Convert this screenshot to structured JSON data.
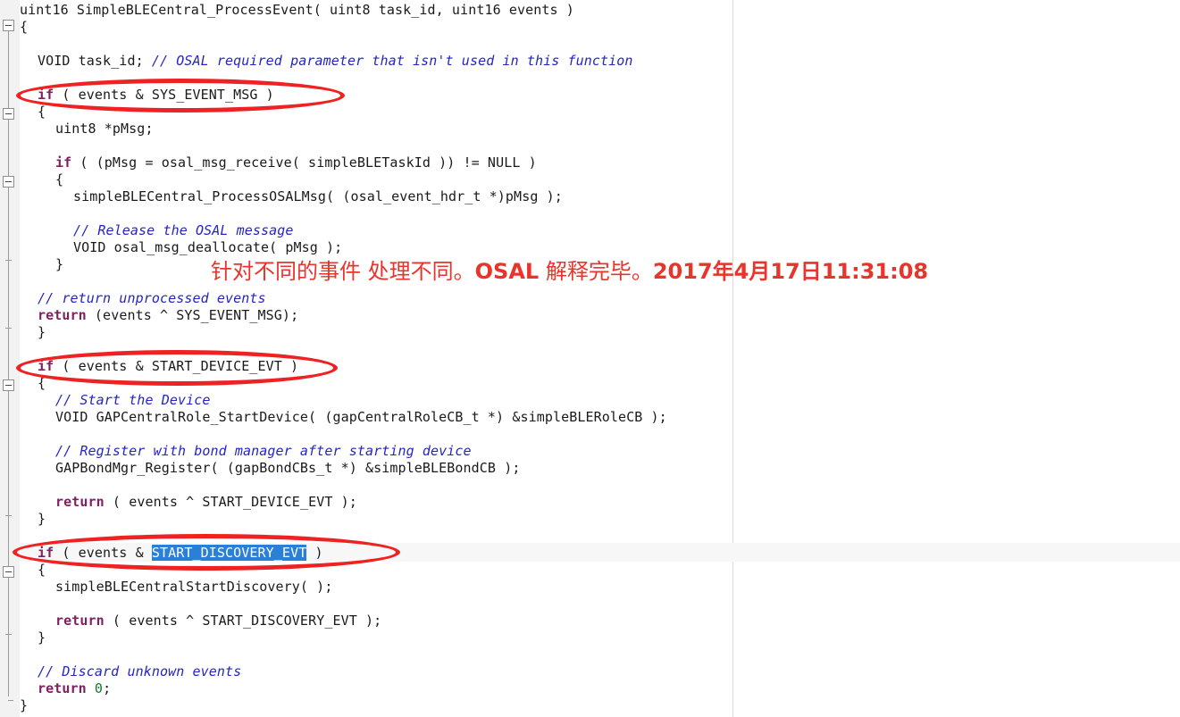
{
  "editor": {
    "language": "c",
    "font_size_px": 15,
    "colors": {
      "background": "#ffffff",
      "text": "#1a1a1a",
      "keyword": "#7f2060",
      "comment": "#2424c8",
      "number": "#107a2f",
      "selection_bg": "#2a7fd6",
      "selection_fg": "#ffffff",
      "gutter_bg": "#f2f2f2",
      "current_line_bg": "#f7f7f7",
      "column_guide": "#dcdcdc",
      "annotation_red": "#ee2222",
      "annotation_text_red": "#e8342a"
    },
    "lines": [
      {
        "indent": 0,
        "text": "uint16 SimpleBLECentral_ProcessEvent( uint8 task_id, uint16 events )"
      },
      {
        "indent": 0,
        "text": "{"
      },
      {
        "indent": 0,
        "text": ""
      },
      {
        "indent": 1,
        "text": "VOID task_id; // OSAL required parameter that isn't used in this function"
      },
      {
        "indent": 1,
        "text": "if ( events & SYS_EVENT_MSG )"
      },
      {
        "indent": 1,
        "text": "{"
      },
      {
        "indent": 2,
        "text": "uint8 *pMsg;"
      },
      {
        "indent": 0,
        "text": ""
      },
      {
        "indent": 2,
        "text": "if ( (pMsg = osal_msg_receive( simpleBLETaskId )) != NULL )"
      },
      {
        "indent": 2,
        "text": "{"
      },
      {
        "indent": 3,
        "text": "simpleBLECentral_ProcessOSALMsg( (osal_event_hdr_t *)pMsg );"
      },
      {
        "indent": 0,
        "text": ""
      },
      {
        "indent": 3,
        "text": "// Release the OSAL message"
      },
      {
        "indent": 3,
        "text": "VOID osal_msg_deallocate( pMsg );"
      },
      {
        "indent": 2,
        "text": "}"
      },
      {
        "indent": 0,
        "text": ""
      },
      {
        "indent": 2,
        "text": "// return unprocessed events"
      },
      {
        "indent": 2,
        "text": "return (events ^ SYS_EVENT_MSG);"
      },
      {
        "indent": 1,
        "text": "}"
      },
      {
        "indent": 0,
        "text": ""
      },
      {
        "indent": 1,
        "text": "if ( events & START_DEVICE_EVT )"
      },
      {
        "indent": 1,
        "text": "{"
      },
      {
        "indent": 2,
        "text": "// Start the Device"
      },
      {
        "indent": 2,
        "text": "VOID GAPCentralRole_StartDevice( (gapCentralRoleCB_t *) &simpleBLERoleCB );"
      },
      {
        "indent": 0,
        "text": ""
      },
      {
        "indent": 2,
        "text": "// Register with bond manager after starting device"
      },
      {
        "indent": 2,
        "text": "GAPBondMgr_Register( (gapBondCBs_t *) &simpleBLEBondCB );"
      },
      {
        "indent": 0,
        "text": ""
      },
      {
        "indent": 2,
        "text": "return ( events ^ START_DEVICE_EVT );"
      },
      {
        "indent": 1,
        "text": "}"
      },
      {
        "indent": 0,
        "text": ""
      },
      {
        "indent": 1,
        "text": "if ( events & START_DISCOVERY_EVT )"
      },
      {
        "indent": 1,
        "text": "{"
      },
      {
        "indent": 2,
        "text": "simpleBLECentralStartDiscovery( );"
      },
      {
        "indent": 0,
        "text": ""
      },
      {
        "indent": 2,
        "text": "return ( events ^ START_DISCOVERY_EVT );"
      },
      {
        "indent": 1,
        "text": "}"
      },
      {
        "indent": 0,
        "text": ""
      },
      {
        "indent": 1,
        "text": "// Discard unknown events"
      },
      {
        "indent": 1,
        "text": "return 0;"
      },
      {
        "indent": 0,
        "text": "}"
      }
    ],
    "selection": {
      "text": "START_DISCOVERY_EVT",
      "line_text": "if ( events & START_DISCOVERY_EVT )"
    }
  },
  "code": {
    "l1_a": "uint16 SimpleBLECentral_ProcessEvent( uint8 task_id, uint16 events )",
    "l2": "{",
    "l4_a": "VOID task_id; ",
    "l4_b": "// OSAL required parameter that isn't used in this function",
    "l5_kw": "if",
    "l5_rest": " ( events & SYS_EVENT_MSG )",
    "l6": "{",
    "l7": "uint8 *pMsg;",
    "l9_kw": "if",
    "l9_rest": " ( (pMsg = osal_msg_receive( simpleBLETaskId )) != NULL )",
    "l10": "{",
    "l11": "simpleBLECentral_ProcessOSALMsg( (osal_event_hdr_t *)pMsg );",
    "l13": "// Release the OSAL message",
    "l14": "VOID osal_msg_deallocate( pMsg );",
    "l15": "}",
    "l17": "// return unprocessed events",
    "l18_kw": "return",
    "l18_rest": " (events ^ SYS_EVENT_MSG);",
    "l19": "}",
    "l21_kw": "if",
    "l21_rest": " ( events & START_DEVICE_EVT )",
    "l22": "{",
    "l23": "// Start the Device",
    "l24": "VOID GAPCentralRole_StartDevice( (gapCentralRoleCB_t *) &simpleBLERoleCB );",
    "l26": "// Register with bond manager after starting device",
    "l27": "GAPBondMgr_Register( (gapBondCBs_t *) &simpleBLEBondCB );",
    "l29_kw": "return",
    "l29_rest": " ( events ^ START_DEVICE_EVT );",
    "l30": "}",
    "l32_kw": "if",
    "l32_pre": " ( events & ",
    "l32_sel": "START_DISCOVERY_EVT",
    "l32_post": " )",
    "l33": "{",
    "l34": "simpleBLECentralStartDiscovery( );",
    "l36_kw": "return",
    "l36_rest": " ( events ^ START_DISCOVERY_EVT );",
    "l37": "}",
    "l39": "// Discard unknown events",
    "l40_kw": "return",
    "l40_num": " 0",
    "l40_end": ";",
    "l41": "}"
  },
  "annotations": {
    "note_part1": "针对不同的事件 处理不同。",
    "note_osal": "OSAL",
    "note_part2": " 解释完毕。",
    "note_timestamp": "2017年4月17日11:31:08",
    "ellipse_targets": [
      "if ( events & SYS_EVENT_MSG )",
      "if ( events & START_DEVICE_EVT )",
      "if ( events & START_DISCOVERY_EVT )"
    ]
  }
}
